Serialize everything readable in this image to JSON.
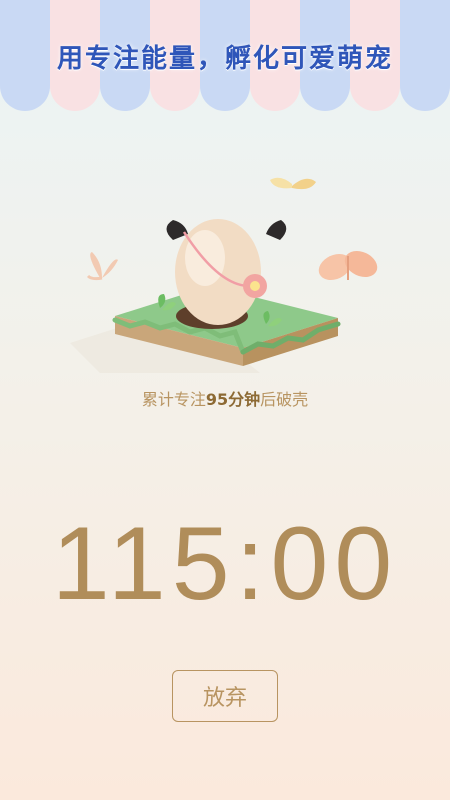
{
  "banner": {
    "headline": "用专注能量，孵化可爱萌宠",
    "stripe_colors": [
      "#c9d9f4",
      "#f9e1e3"
    ]
  },
  "pet": {
    "caption_prefix": "累计专注",
    "caption_minutes": "95分钟",
    "caption_suffix": "后破壳",
    "icons": [
      "egg-icon",
      "flower-icon",
      "butterfly-icon",
      "sprout-icon"
    ]
  },
  "timer": {
    "display": "115:00"
  },
  "actions": {
    "give_up_label": "放弃"
  },
  "colors": {
    "accent": "#b08d5a",
    "headline": "#2f56b9"
  }
}
